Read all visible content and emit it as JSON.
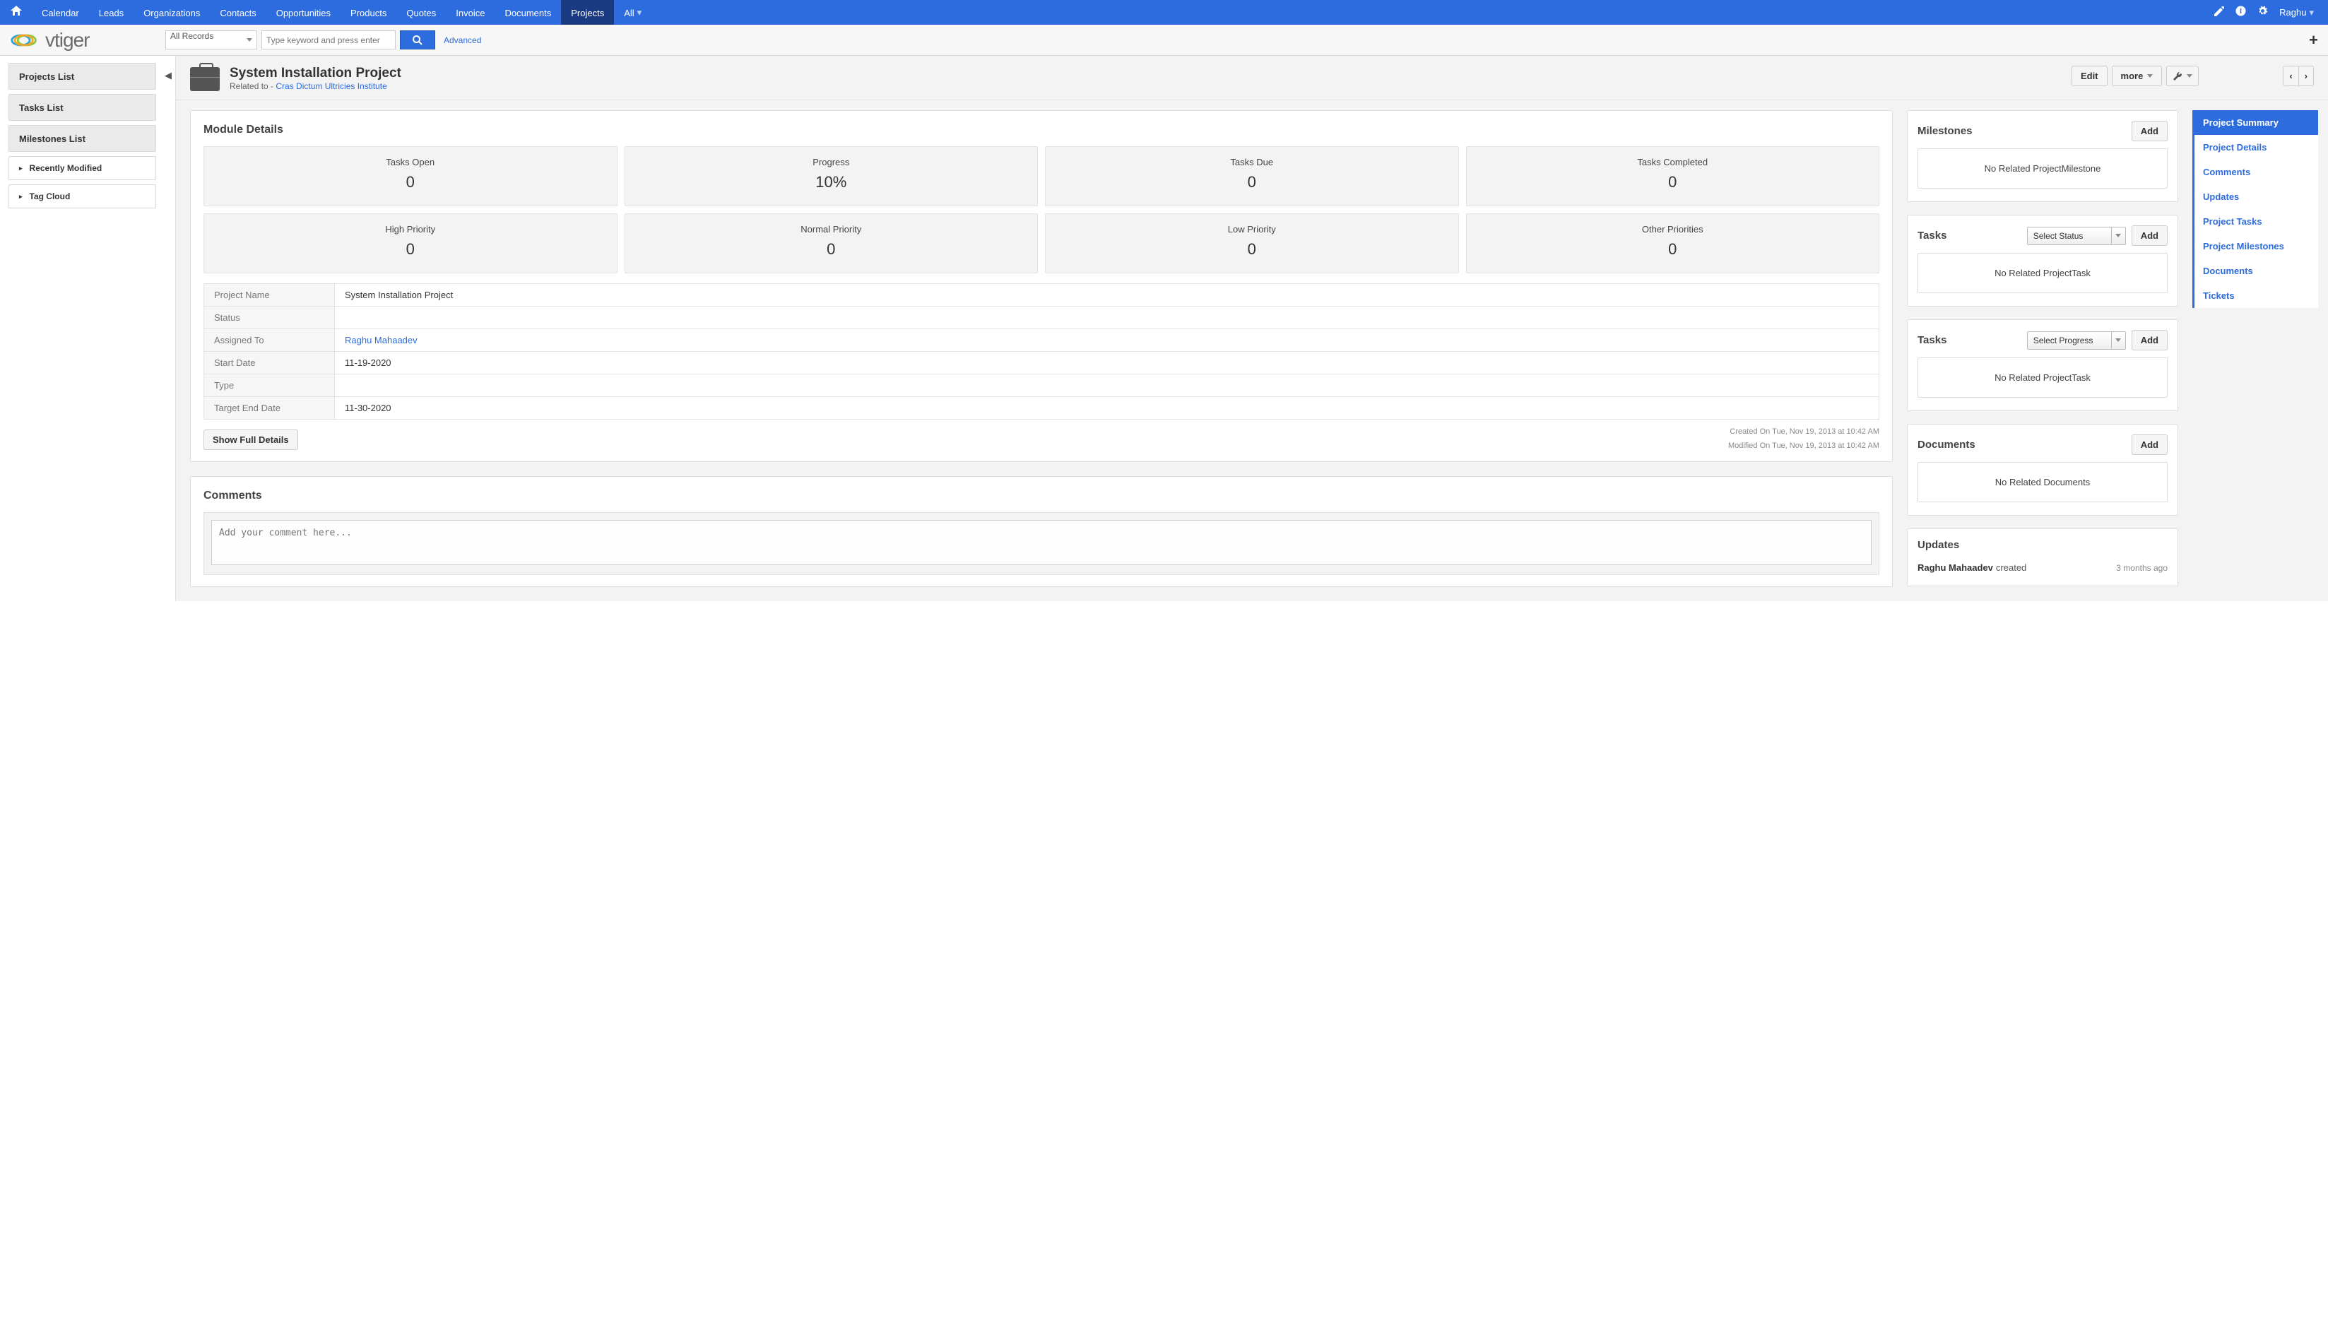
{
  "topnav": {
    "items": [
      "Calendar",
      "Leads",
      "Organizations",
      "Contacts",
      "Opportunities",
      "Products",
      "Quotes",
      "Invoice",
      "Documents",
      "Projects",
      "All"
    ],
    "active": "Projects",
    "user": "Raghu"
  },
  "search": {
    "scope": "All Records",
    "placeholder": "Type keyword and press enter",
    "advanced": "Advanced"
  },
  "sidebar": {
    "lists": [
      "Projects List",
      "Tasks List",
      "Milestones List"
    ],
    "subs": [
      "Recently Modified",
      "Tag Cloud"
    ]
  },
  "header": {
    "title": "System Installation Project",
    "related_prefix": "Related to - ",
    "related_link": "Cras Dictum Ultricies Institute",
    "edit": "Edit",
    "more": "more"
  },
  "module": {
    "heading": "Module Details",
    "row1": [
      {
        "label": "Tasks Open",
        "value": "0"
      },
      {
        "label": "Progress",
        "value": "10%"
      },
      {
        "label": "Tasks Due",
        "value": "0"
      },
      {
        "label": "Tasks Completed",
        "value": "0"
      }
    ],
    "row2": [
      {
        "label": "High Priority",
        "value": "0"
      },
      {
        "label": "Normal Priority",
        "value": "0"
      },
      {
        "label": "Low Priority",
        "value": "0"
      },
      {
        "label": "Other Priorities",
        "value": "0"
      }
    ],
    "fields": [
      {
        "k": "Project Name",
        "v": "System Installation Project",
        "link": false
      },
      {
        "k": "Status",
        "v": "",
        "link": false
      },
      {
        "k": "Assigned To",
        "v": "Raghu Mahaadev",
        "link": true
      },
      {
        "k": "Start Date",
        "v": "11-19-2020",
        "link": false
      },
      {
        "k": "Type",
        "v": "",
        "link": false
      },
      {
        "k": "Target End Date",
        "v": "11-30-2020",
        "link": false
      }
    ],
    "created": "Created On Tue, Nov 19, 2013 at 10:42 AM",
    "modified": "Modified On Tue, Nov 19, 2013 at 10:42 AM",
    "show_full": "Show Full Details"
  },
  "comments": {
    "heading": "Comments",
    "placeholder": "Add your comment here..."
  },
  "panels": {
    "milestones": {
      "title": "Milestones",
      "add": "Add",
      "empty": "No Related ProjectMilestone"
    },
    "tasks_status": {
      "title": "Tasks",
      "select": "Select Status",
      "add": "Add",
      "empty": "No Related ProjectTask"
    },
    "tasks_progress": {
      "title": "Tasks",
      "select": "Select Progress",
      "add": "Add",
      "empty": "No Related ProjectTask"
    },
    "documents": {
      "title": "Documents",
      "add": "Add",
      "empty": "No Related Documents"
    },
    "updates": {
      "title": "Updates",
      "who": "Raghu Mahaadev",
      "what": "created",
      "when": "3 months ago"
    }
  },
  "sidetabs": [
    "Project Summary",
    "Project Details",
    "Comments",
    "Updates",
    "Project Tasks",
    "Project Milestones",
    "Documents",
    "Tickets"
  ],
  "sidetab_active": "Project Summary"
}
